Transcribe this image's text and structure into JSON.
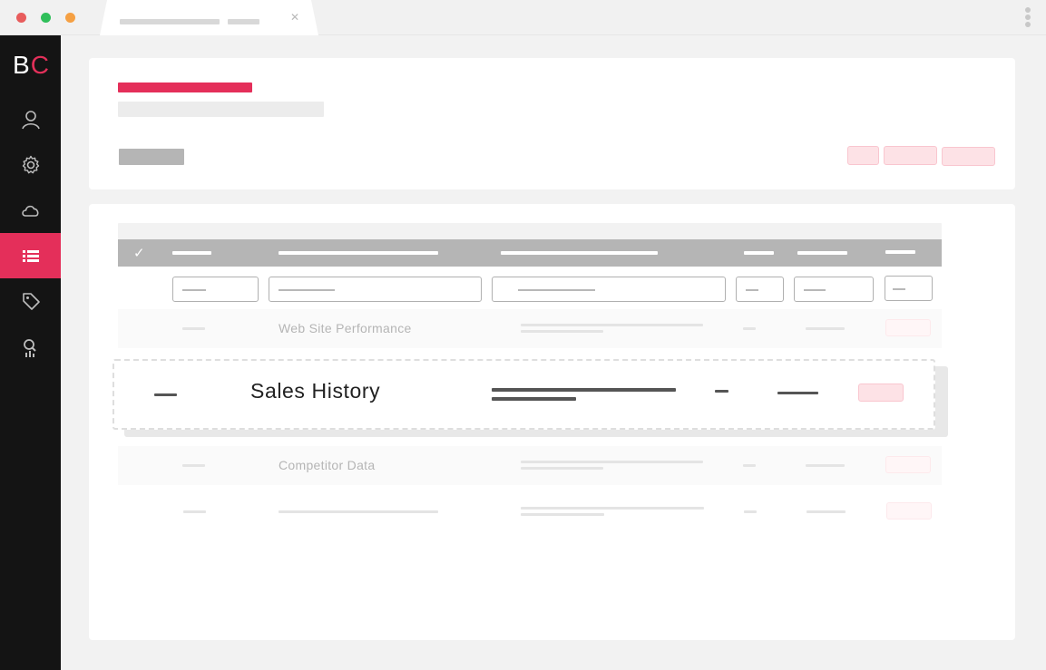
{
  "app": {
    "logo_first": "B",
    "logo_second": "C",
    "accent_color": "#e42f5a"
  },
  "window": {
    "traffic_lights": [
      "#e85c5c",
      "#2fbf5a",
      "#f5a043"
    ],
    "tab_close_glyph": "✕"
  },
  "sidebar": {
    "items": [
      {
        "icon": "user-icon",
        "active": false
      },
      {
        "icon": "gear-icon",
        "active": false
      },
      {
        "icon": "cloud-icon",
        "active": false
      },
      {
        "icon": "list-icon",
        "active": true
      },
      {
        "icon": "tag-icon",
        "active": false
      },
      {
        "icon": "search-analytics-icon",
        "active": false
      }
    ]
  },
  "table": {
    "header_check_glyph": "✓",
    "rows": [
      {
        "title": "Web Site Performance",
        "state": "faded"
      },
      {
        "title": "Sales History",
        "state": "dragging"
      },
      {
        "title": "Competitor Data",
        "state": "faded"
      },
      {
        "title": "",
        "state": "faded"
      }
    ]
  }
}
